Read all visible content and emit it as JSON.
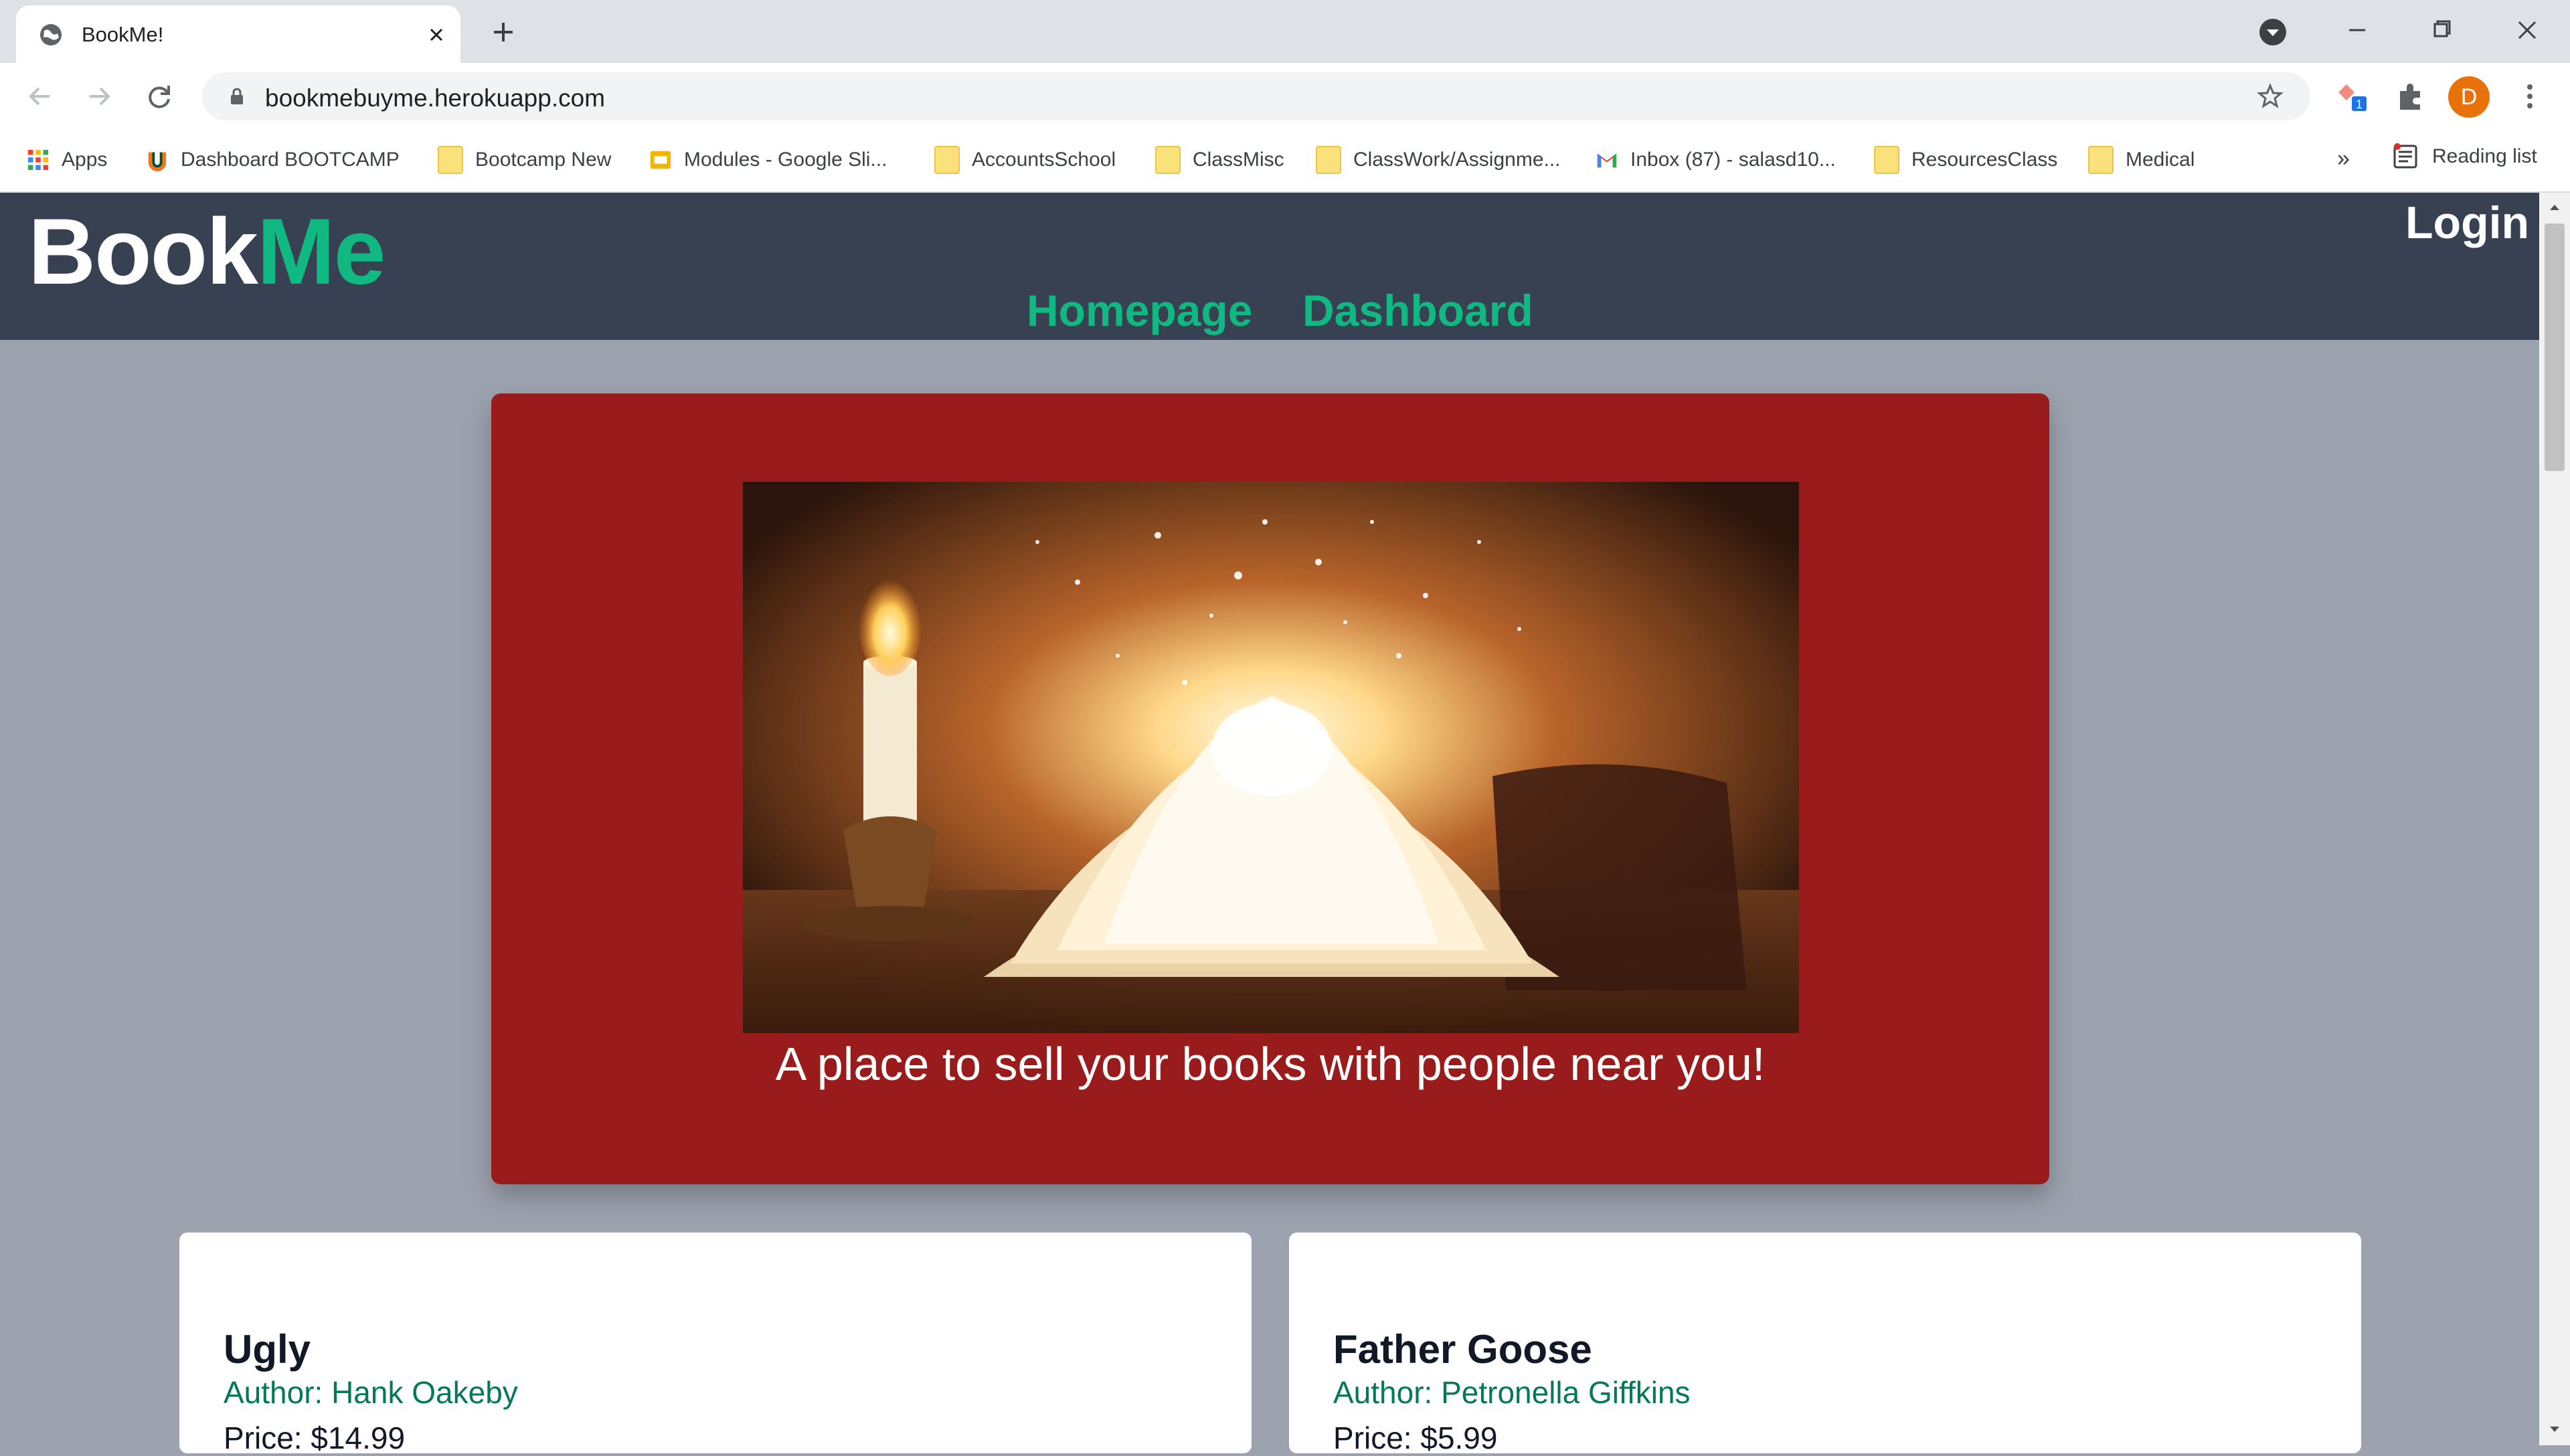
{
  "browser": {
    "tab_title": "BookMe!",
    "url": "bookmebuyme.herokuapp.com",
    "profile_initial": "D",
    "extension_badge": "1",
    "bookmarks": [
      {
        "label": "Apps",
        "icon": "apps-grid-icon"
      },
      {
        "label": "Dashboard BOOTCAMP",
        "icon": "u-logo-icon"
      },
      {
        "label": "Bootcamp New",
        "icon": "folder-icon"
      },
      {
        "label": "Modules - Google Sli...",
        "icon": "google-slides-icon"
      },
      {
        "label": "AccountsSchool",
        "icon": "folder-icon"
      },
      {
        "label": "ClassMisc",
        "icon": "folder-icon"
      },
      {
        "label": "ClassWork/Assignme...",
        "icon": "folder-icon"
      },
      {
        "label": "Inbox (87) - salasd10...",
        "icon": "gmail-icon"
      },
      {
        "label": "ResourcesClass",
        "icon": "folder-icon"
      },
      {
        "label": "Medical",
        "icon": "folder-icon"
      }
    ],
    "overflow_label": "»",
    "reading_list": "Reading list"
  },
  "header": {
    "logo_part1": "Book",
    "logo_part2": "Me",
    "login": "Login",
    "nav": [
      "Homepage",
      "Dashboard"
    ]
  },
  "hero": {
    "tagline": "A place to sell your books with people near you!"
  },
  "books": [
    {
      "title": "Ugly",
      "author": "Author: Hank Oakeby",
      "price": "Price: $14.99"
    },
    {
      "title": "Father Goose",
      "author": "Author: Petronella Giffkins",
      "price": "Price: $5.99"
    }
  ],
  "colors": {
    "header_bg": "#374151",
    "accent": "#10b981",
    "hero_bg": "#991b1b",
    "page_bg": "#9ca3af",
    "author": "#047857"
  }
}
